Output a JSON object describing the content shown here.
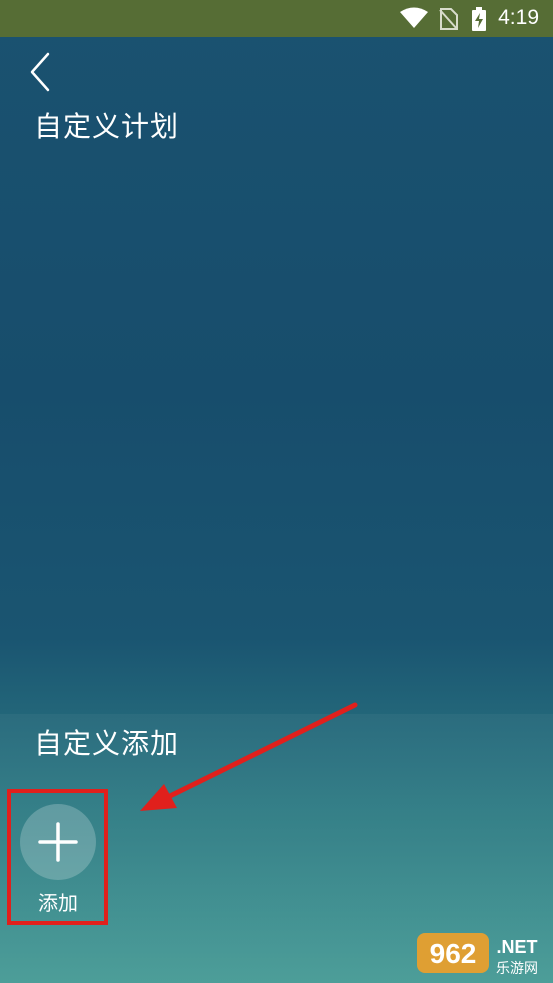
{
  "status_bar": {
    "time": "4:19",
    "background": "#566d35",
    "icons": [
      "wifi-icon",
      "no-sim-icon",
      "battery-charging-icon"
    ]
  },
  "header": {
    "back_icon": "chevron-left-icon",
    "title": "自定义计划"
  },
  "custom_section": {
    "title": "自定义添加",
    "add_button": {
      "icon": "plus-icon",
      "label": "添加"
    }
  },
  "annotation": {
    "highlight_color": "#e0201c",
    "arrow_color": "#e0201c"
  },
  "watermark": {
    "brand": "962",
    "suffix": ".NET",
    "subtitle": "乐游网"
  }
}
